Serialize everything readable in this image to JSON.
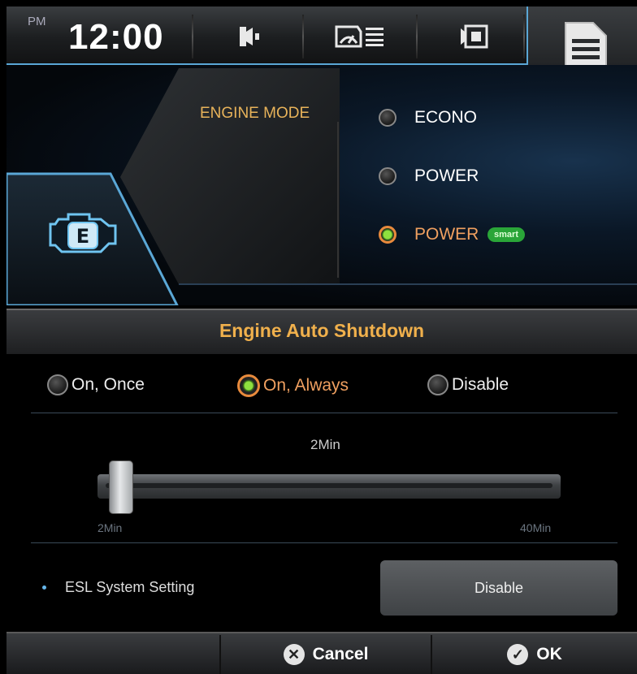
{
  "status_bar": {
    "ampm": "PM",
    "time": "12:00"
  },
  "engine_mode": {
    "label": "ENGINE MODE",
    "options": [
      {
        "label": "ECONO",
        "selected": false
      },
      {
        "label": "POWER",
        "selected": false
      },
      {
        "label": "POWER",
        "selected": true,
        "badge": "smart"
      }
    ]
  },
  "auto_shutdown": {
    "title": "Engine Auto Shutdown",
    "options": [
      {
        "label": "On, Once",
        "selected": false
      },
      {
        "label": "On, Always",
        "selected": true
      },
      {
        "label": "Disable",
        "selected": false
      }
    ],
    "slider": {
      "current": "2Min",
      "min_label": "2Min",
      "max_label": "40Min",
      "value_fraction": 0.0
    },
    "esl": {
      "label": "ESL System Setting",
      "button": "Disable"
    }
  },
  "footer": {
    "cancel": "Cancel",
    "ok": "OK"
  },
  "colors": {
    "accent_blue": "#5aa7d6",
    "label_orange": "#e8b35a",
    "selected_ring": "#e88a3c",
    "selected_dot": "#8ee03f",
    "smart_badge": "#2aa538"
  },
  "icons": [
    "speaker-icon",
    "gauge-display-icon",
    "screen-mode-icon",
    "menu-document-icon",
    "check-engine-icon",
    "cancel-x-icon",
    "ok-check-icon"
  ]
}
